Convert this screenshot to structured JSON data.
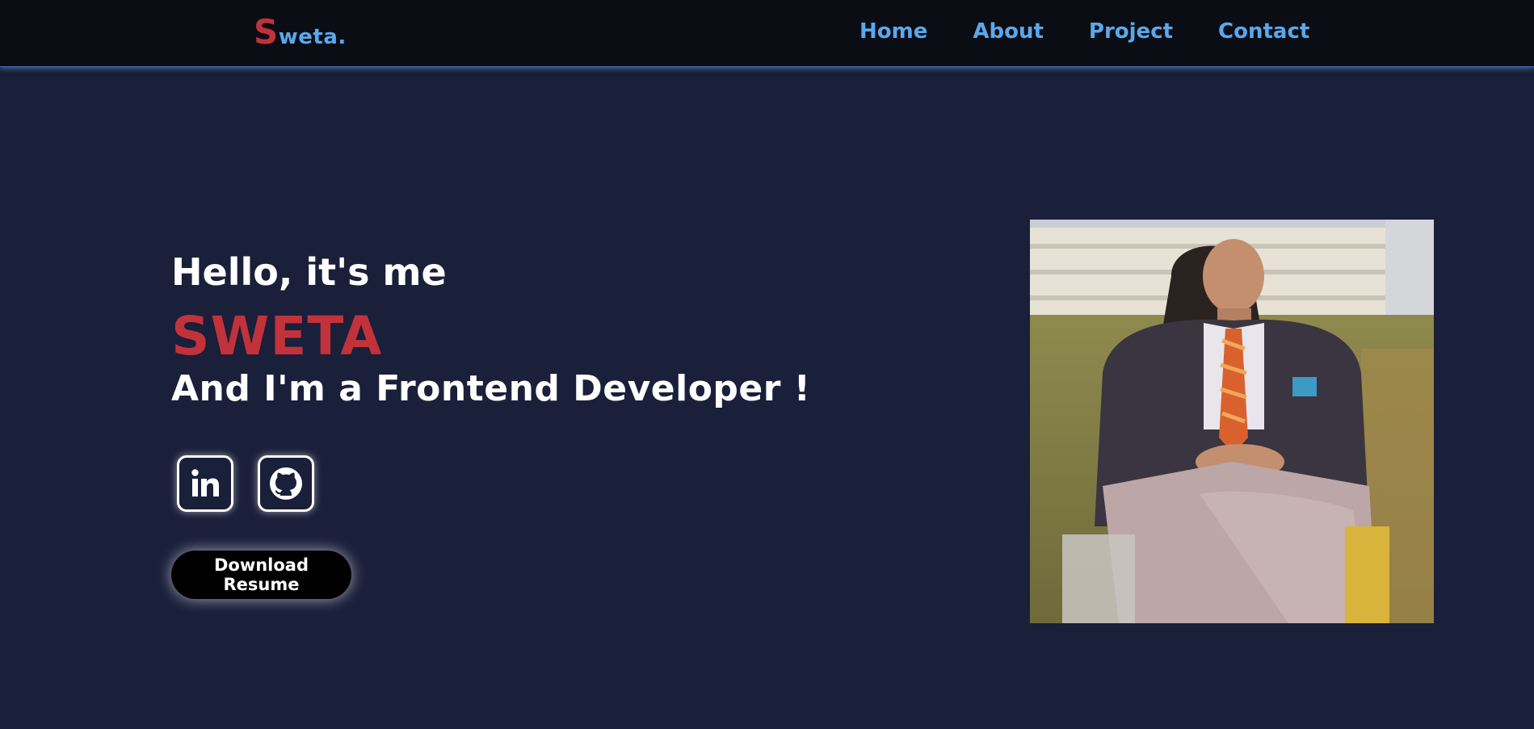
{
  "brand": {
    "first_letter": "S",
    "rest": "weta."
  },
  "nav": {
    "items": [
      {
        "label": "Home"
      },
      {
        "label": "About"
      },
      {
        "label": "Project"
      },
      {
        "label": "Contact"
      }
    ]
  },
  "hero": {
    "greeting": "Hello, it's me",
    "name": "SWETA",
    "tagline": "And I'm a Frontend Developer !",
    "resume_label": "Download Resume"
  },
  "social": {
    "linkedin_icon": "linkedin-icon",
    "github_icon": "github-icon"
  },
  "colors": {
    "background": "#1a1f3a",
    "navbar": "#0b0d14",
    "accent_red": "#c1323a",
    "accent_blue": "#5aa8ec",
    "text": "#ffffff"
  }
}
